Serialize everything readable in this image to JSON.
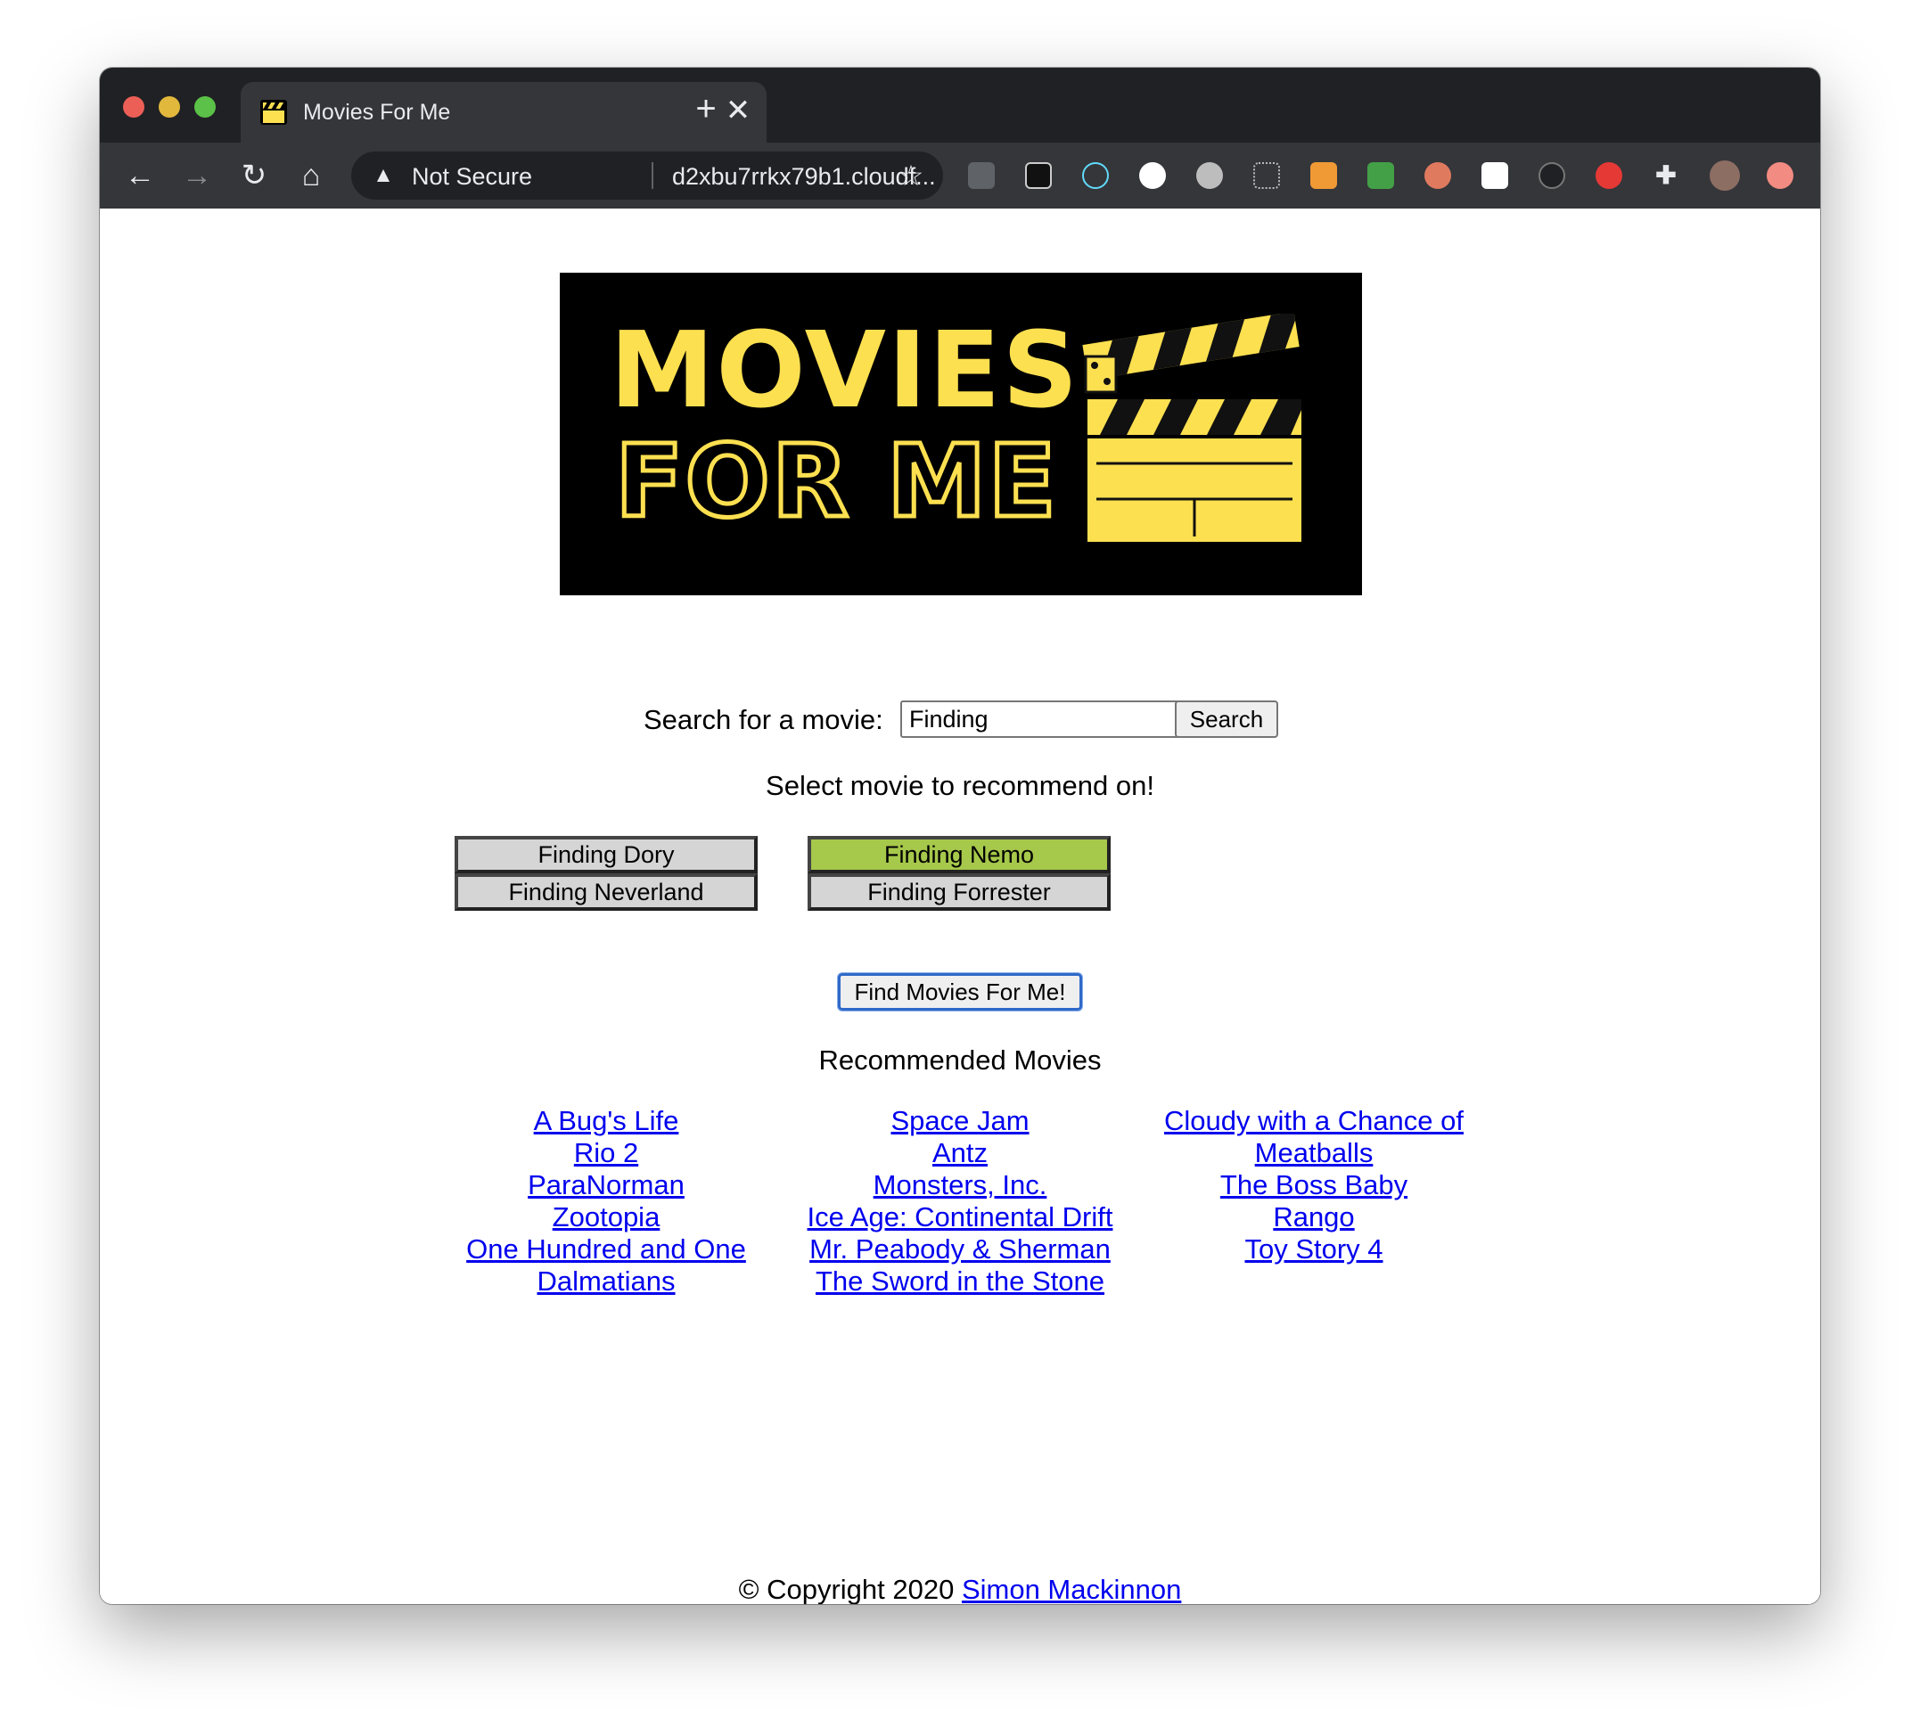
{
  "browser": {
    "tab_title": "Movies For Me",
    "tab_close": "✕",
    "new_tab": "+",
    "address": {
      "security_label": "Not Secure",
      "url": "d2xbu7rrkx79b1.cloudf..."
    }
  },
  "logo": {
    "line1": "MOVIES",
    "line2": "FOR ME",
    "colors": {
      "accent": "#fde050",
      "background": "#000000"
    }
  },
  "search": {
    "label": "Search for a movie:",
    "value": "Finding",
    "button_label": "Search"
  },
  "selection": {
    "title": "Select movie to recommend on!",
    "options": [
      {
        "label": "Finding Dory",
        "selected": false
      },
      {
        "label": "Finding Nemo",
        "selected": true
      },
      {
        "label": "Finding Neverland",
        "selected": false
      },
      {
        "label": "Finding Forrester",
        "selected": false
      }
    ],
    "selected_color": "#a6c84b"
  },
  "find_button_label": "Find Movies For Me!",
  "recommendations": {
    "title": "Recommended Movies",
    "columns": [
      [
        "A Bug's Life",
        "Rio 2",
        "ParaNorman",
        "Zootopia",
        "One Hundred and One Dalmatians"
      ],
      [
        "Space Jam",
        "Antz",
        "Monsters, Inc.",
        "Ice Age: Continental Drift",
        "Mr. Peabody & Sherman",
        "The Sword in the Stone"
      ],
      [
        "Cloudy with a Chance of Meatballs",
        "The Boss Baby",
        "Rango",
        "Toy Story 4"
      ]
    ]
  },
  "footer": {
    "text": "© Copyright 2020",
    "author_link": "Simon Mackinnon"
  }
}
